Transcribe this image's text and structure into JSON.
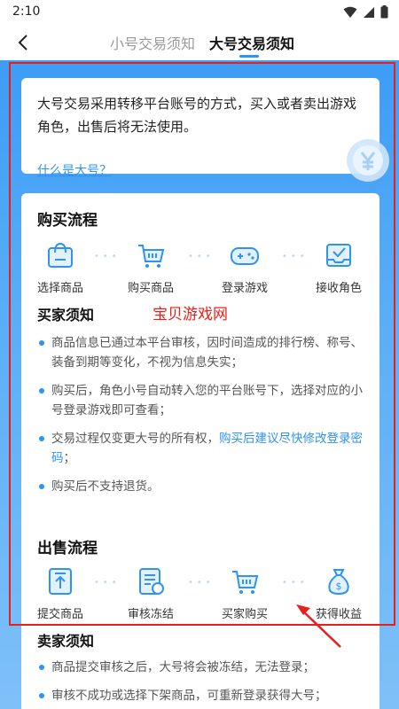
{
  "status": {
    "time": "2:10",
    "icons": [
      "wifi-icon",
      "signal-icon",
      "battery-icon"
    ]
  },
  "nav": {
    "tabs": [
      {
        "label": "小号交易须知",
        "active": false
      },
      {
        "label": "大号交易须知",
        "active": true
      }
    ]
  },
  "intro": {
    "text": "大号交易采用转移平台账号的方式，买入或者卖出游戏角色，出售后将无法使用。",
    "link": "什么是大号？"
  },
  "buy": {
    "title": "购买流程",
    "steps": [
      {
        "label": "选择商品",
        "icon": "shopping-bag-icon"
      },
      {
        "label": "购买商品",
        "icon": "cart-icon"
      },
      {
        "label": "登录游戏",
        "icon": "gamepad-icon"
      },
      {
        "label": "接收角色",
        "icon": "inbox-receive-icon"
      }
    ],
    "notes_title": "买家须知",
    "watermark": "宝贝游戏网",
    "notes": [
      {
        "text": "商品信息已通过本平台审核，因时间造成的排行榜、称号、装备到期等变化，不视为信息失实；"
      },
      {
        "text": "购买后，角色小号自动转入您的平台账号下，选择对应的小号登录游戏即可查看；"
      },
      {
        "text": "交易过程仅变更大号的所有权，",
        "highlight": "购买后建议尽快修改登录密码",
        "suffix": "；"
      },
      {
        "text": "购买后不支持退货。"
      }
    ]
  },
  "sell": {
    "title": "出售流程",
    "steps": [
      {
        "label": "提交商品",
        "icon": "upload-icon"
      },
      {
        "label": "审核冻结",
        "icon": "review-doc-icon"
      },
      {
        "label": "买家购买",
        "icon": "cart-icon"
      },
      {
        "label": "获得收益",
        "icon": "money-bag-icon"
      }
    ],
    "notes_title": "卖家须知",
    "notes": [
      {
        "text": "商品提交审核之后，大号将会被冻结，无法登录；"
      },
      {
        "text": "审核不成功或选择下架商品，可重新登录获得大号；"
      }
    ]
  },
  "colors": {
    "accent": "#2f93f0",
    "background_gradient_top": "#3d9cf5",
    "annotation_red": "#e8201c"
  }
}
